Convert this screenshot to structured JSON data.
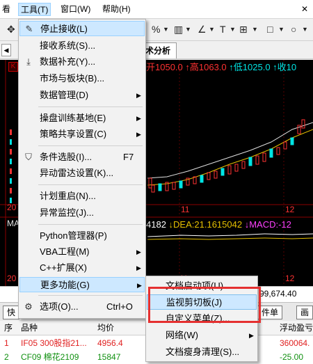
{
  "menubar": {
    "partial_left": "看",
    "tools": "工具(T)",
    "window": "窗口(W)",
    "help": "帮助(H)",
    "close_glyph": "✕"
  },
  "toolbar": {
    "percent": "%"
  },
  "tab": {
    "label": "术分析"
  },
  "chart": {
    "k_badge": "K",
    "info_open": "开1050.0",
    "info_high": "↑高1063.0",
    "info_low": "↑低1025.0",
    "info_close": "↑收10",
    "macd_part1": "4182",
    "macd_dea": "↓DEA:21.1615042",
    "macd_macd": "↓MACD:-12",
    "axis_11": "11",
    "axis_12": "12",
    "axis_20_a": "20",
    "axis_20_b": "20",
    "left_label_ma": "MA",
    "left_label_di": "D",
    "colors": {
      "up": "#ff3232",
      "down": "#00e5e5",
      "bg": "#000000"
    }
  },
  "status": {
    "amount": "99,674.40"
  },
  "buttons": {
    "quick": "快",
    "order": "件单",
    "partial_right": "画"
  },
  "table": {
    "headers": [
      "序",
      "品种",
      "均价",
      "浮动盈亏"
    ],
    "rows": [
      {
        "idx": "1",
        "name": "IF05 300股指21...",
        "price": "4956.4",
        "pnl": "360064.",
        "color": "#e02020"
      },
      {
        "idx": "2",
        "name": "CF09 棉花2109",
        "price": "15847",
        "pnl": "-25.00",
        "color": "#109010"
      }
    ]
  },
  "menu": {
    "items": [
      {
        "label": "停止接收(L)",
        "icon": "pencil-icon",
        "glyph": "✎",
        "highlight": true
      },
      {
        "label": "接收系统(S)..."
      },
      {
        "label": "数据补充(Y)...",
        "icon": "download-icon",
        "glyph": "⤓"
      },
      {
        "label": "市场与板块(B)..."
      },
      {
        "label": "数据管理(D)",
        "submenu": true
      },
      {
        "label": "操盘训练基地(E)",
        "submenu": true
      },
      {
        "label": "策略共享设置(C)",
        "submenu": true
      },
      {
        "label": "条件选股(I)...",
        "icon": "filter-icon",
        "glyph": "⛉",
        "shortcut": "F7"
      },
      {
        "label": "异动雷达设置(K)..."
      },
      {
        "label": "计划重启(N)..."
      },
      {
        "label": "异常监控(J)..."
      },
      {
        "label": "Python管理器(P)"
      },
      {
        "label": "VBA工程(M)",
        "submenu": true
      },
      {
        "label": "C++扩展(X)",
        "submenu": true
      },
      {
        "label": "更多功能(G)",
        "submenu": true,
        "active": true
      },
      {
        "label": "选项(O)...",
        "icon": "gear-icon",
        "glyph": "⚙",
        "shortcut": "Ctrl+O"
      }
    ]
  },
  "submenu": {
    "items": [
      {
        "label": "文档启动项(U)..."
      },
      {
        "label": "监视剪切板(J)",
        "highlight": true
      },
      {
        "label": "自定义菜单(Z)..."
      },
      {
        "label": "网络(W)",
        "submenu": true
      },
      {
        "label": "文档瘦身清理(S)..."
      }
    ]
  }
}
